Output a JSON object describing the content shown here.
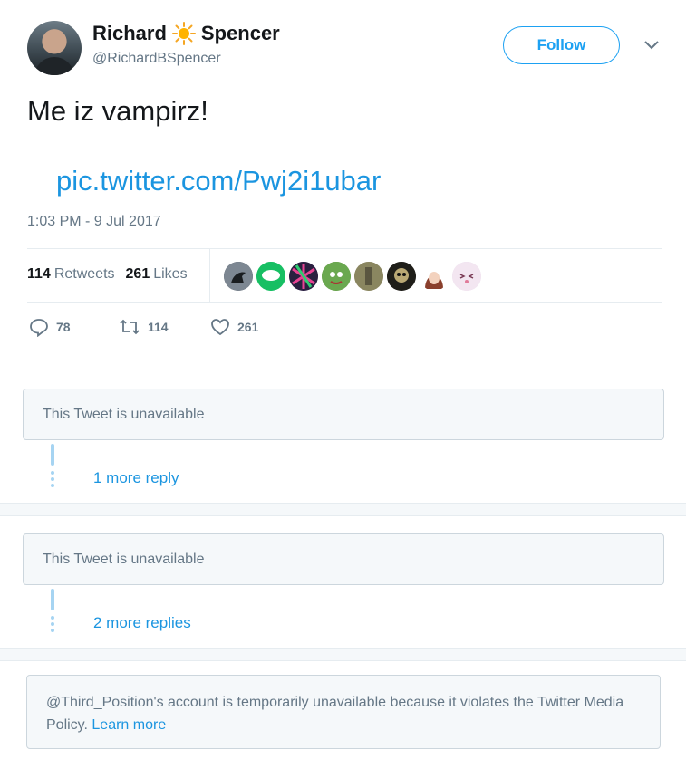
{
  "header": {
    "name_first": "Richard",
    "name_last": "Spencer",
    "handle": "@RichardBSpencer",
    "follow_label": "Follow"
  },
  "tweet": {
    "text": "Me iz vampirz!",
    "link": "pic.twitter.com/Pwj2i1ubar",
    "timestamp": "1:03 PM - 9 Jul 2017"
  },
  "stats": {
    "retweets_count": "114",
    "retweets_label": "Retweets",
    "likes_count": "261",
    "likes_label": "Likes"
  },
  "likers": [
    {
      "name": "crow-avatar",
      "color": "#4a5560"
    },
    {
      "name": "green-chat-avatar",
      "color": "#17bf63"
    },
    {
      "name": "colorful-avatar",
      "color": "#3b2c5a"
    },
    {
      "name": "pepe-avatar",
      "color": "#5a8a3a"
    },
    {
      "name": "statue-avatar",
      "color": "#8a8660"
    },
    {
      "name": "skull-avatar",
      "color": "#2b2a24"
    },
    {
      "name": "anime-girl-avatar",
      "color": "#8a4a3a"
    },
    {
      "name": "anime-face-avatar",
      "color": "#e8d6ea"
    }
  ],
  "actions": {
    "replies": "78",
    "retweets": "114",
    "likes": "261"
  },
  "threads": [
    {
      "unavailable_text": "This Tweet is unavailable",
      "more_label": "1 more reply"
    },
    {
      "unavailable_text": "This Tweet is unavailable",
      "more_label": "2 more replies"
    }
  ],
  "notice": {
    "text": "@Third_Position's account is temporarily unavailable because it violates the Twitter Media Policy.",
    "link": "Learn more"
  }
}
